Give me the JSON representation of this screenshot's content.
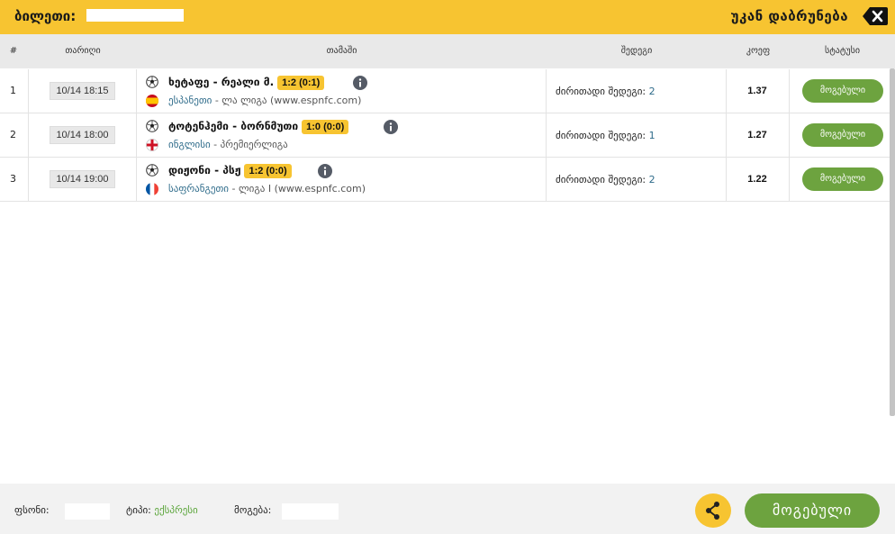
{
  "header": {
    "ticket_label": "ბილეთი:",
    "back_label": "უკან დაბრუნება"
  },
  "columns": {
    "num": "#",
    "date": "თარიღი",
    "game": "თამაში",
    "outcome": "შედეგი",
    "odds": "კოეფ",
    "status": "სტატუსი"
  },
  "rows": [
    {
      "num": "1",
      "date": "10/14 18:15",
      "teams": "ხეტაფე - რეალი მ.",
      "score": "1:2 (0:1)",
      "country": "ესპანეთი",
      "league": " - ლა ლიგა (www.espnfc.com)",
      "result_label": "ძირითადი შედეგი:",
      "result_value": "2",
      "odds": "1.37",
      "status": "მოგებული",
      "flag": "spain-flag"
    },
    {
      "num": "2",
      "date": "10/14 18:00",
      "teams": "ტოტენჰემი - ბორნმუთი",
      "score": "1:0 (0:0)",
      "country": "ინგლისი",
      "league": " - პრემიერლიგა",
      "result_label": "ძირითადი შედეგი:",
      "result_value": "1",
      "odds": "1.27",
      "status": "მოგებული",
      "flag": "england-flag"
    },
    {
      "num": "3",
      "date": "10/14 19:00",
      "teams": "დიჟონი - პსჟ",
      "score": "1:2 (0:0)",
      "country": "საფრანგეთი",
      "league": " - ლიგა I (www.espnfc.com)",
      "result_label": "ძირითადი შედეგი:",
      "result_value": "2",
      "odds": "1.22",
      "status": "მოგებული",
      "flag": "france-flag"
    }
  ],
  "footer": {
    "stake_label": "ფსონი:",
    "type_label": "ტიპი:",
    "type_value": "ექსპრესი",
    "win_label": "მოგება:",
    "won_button": "მოგებული"
  },
  "colors": {
    "accent": "#f7c431",
    "success": "#6da33f",
    "link": "#2e6b8a"
  }
}
